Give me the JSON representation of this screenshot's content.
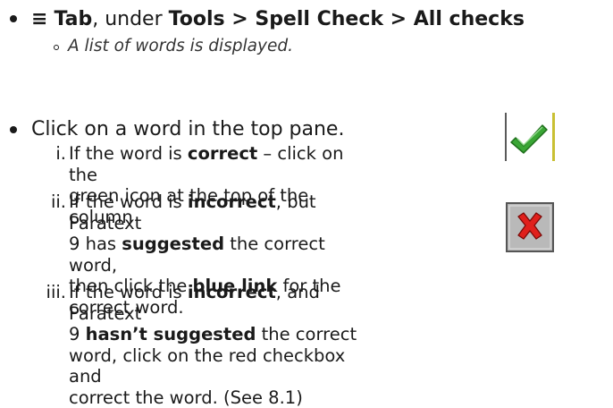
{
  "step1": {
    "hamburger": "≡",
    "tab_label": "Tab",
    "under": ", under ",
    "tools": "Tools",
    "sep1": " > ",
    "spell_check": "Spell Check",
    "sep2": " > ",
    "all_checks": "All checks",
    "sub_item": "A list of words is displayed."
  },
  "step2": {
    "main": "Click on a word in the top pane.",
    "items": [
      {
        "num": "i.",
        "a": "If the word is ",
        "b": "correct",
        "c": " – click on the",
        "line2": "green icon at the top of the column"
      },
      {
        "num": "ii.",
        "a": "If the word is ",
        "b": "incorrect",
        "c": ", but Paratext",
        "l2a": "9 has ",
        "l2b": "suggested",
        "l2c": " the correct word,",
        "l3a": "then click the ",
        "l3b": "blue link",
        "l3c": " for the",
        "l4": "correct word."
      },
      {
        "num": "iii.",
        "a": "If the word is ",
        "b": "incorrect",
        "c": ", and Paratext",
        "l2a": "9 ",
        "l2b": "hasn’t suggested",
        "l2c": " the correct",
        "l3": "word, click on the red checkbox and",
        "l4": "correct the word. (See 8.1)"
      }
    ]
  },
  "icons": {
    "check_icon": "green-check-icon",
    "x_icon": "red-x-icon",
    "check_color": "#3aa635",
    "x_color": "#e0201c",
    "x_bg": "#b9b9b9"
  }
}
